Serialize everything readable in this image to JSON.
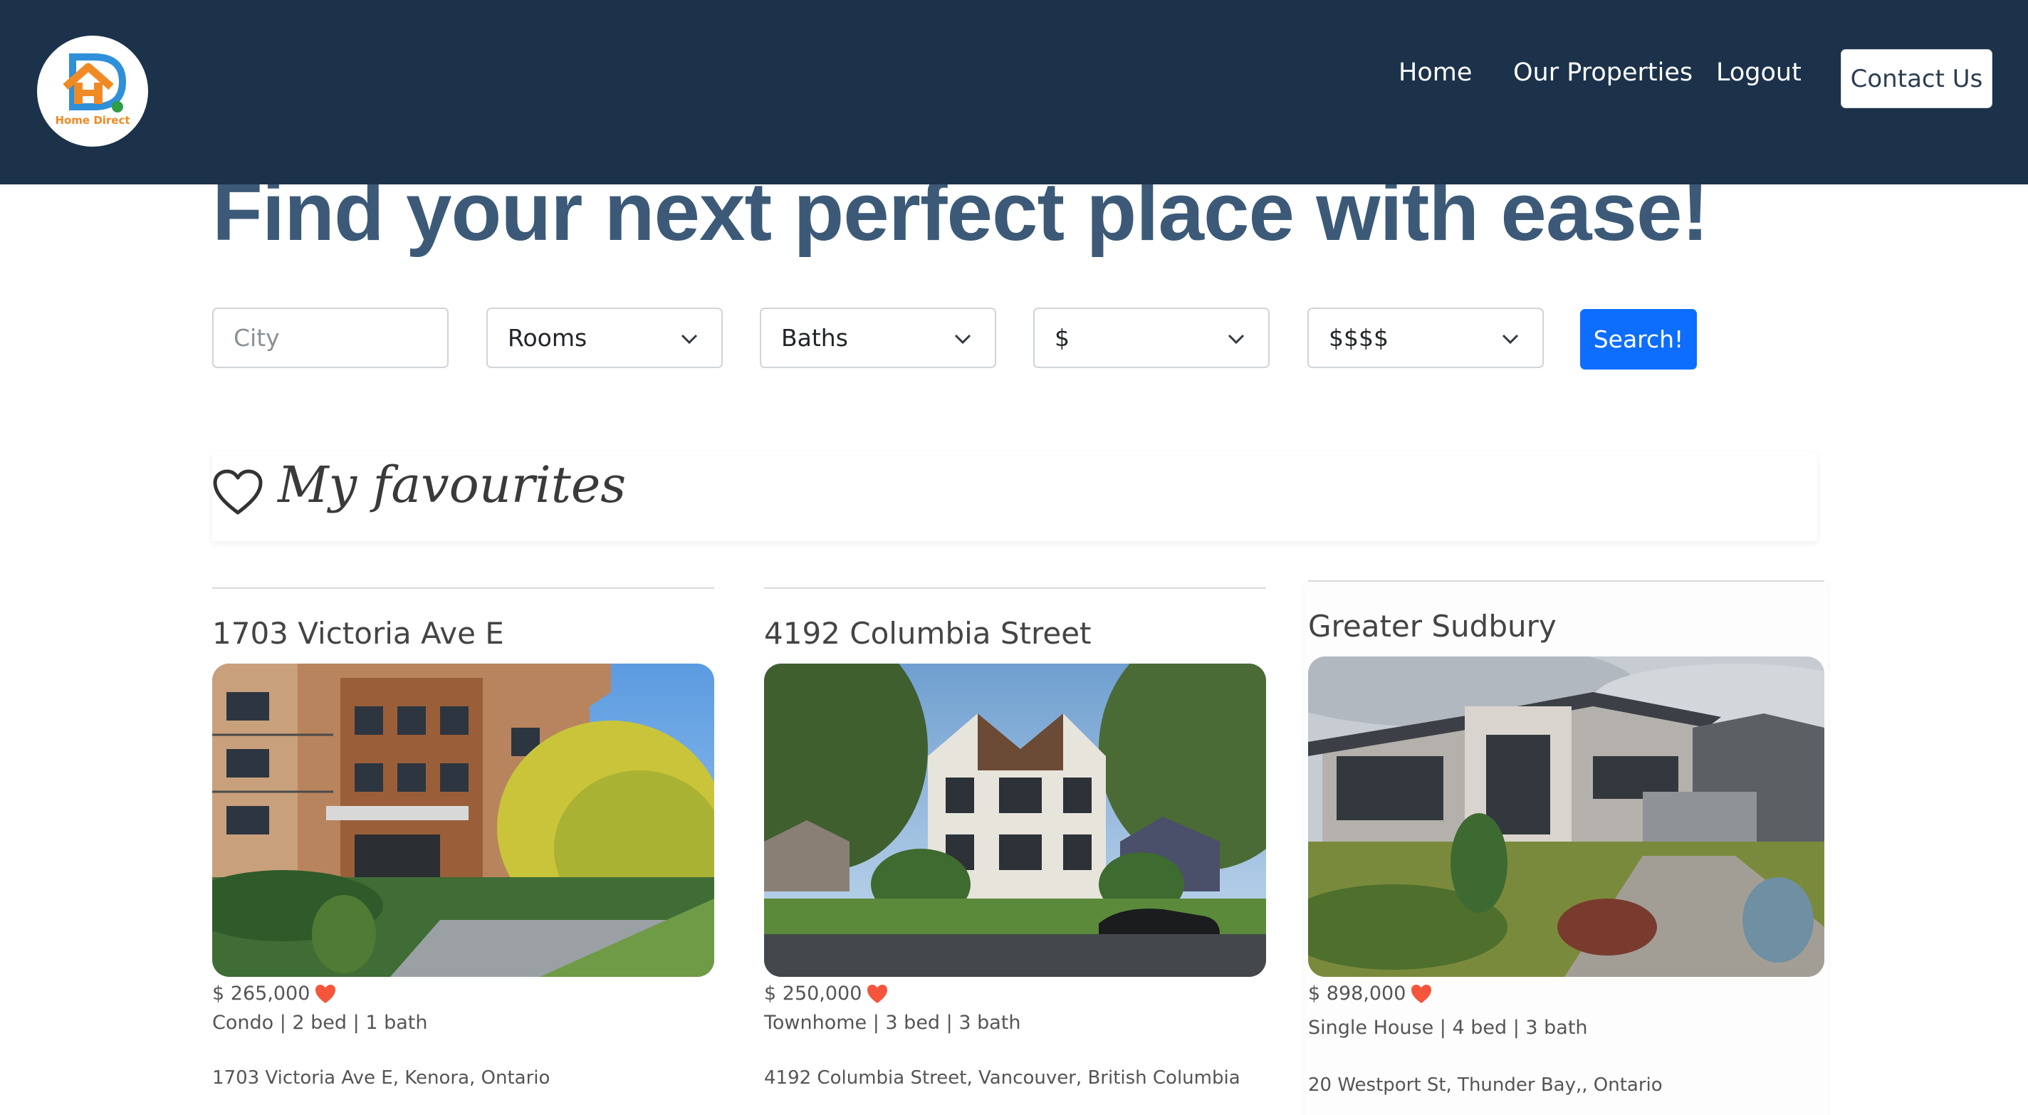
{
  "brand": {
    "logo_text": "Home Direct",
    "primary_color": "#1c324b",
    "accent": "#f08a24"
  },
  "nav": {
    "home": "Home",
    "properties": "Our Properties",
    "logout": "Logout",
    "contact": "Contact Us"
  },
  "hero": {
    "title": "Find your next perfect place with ease!"
  },
  "search": {
    "city_placeholder": "City",
    "rooms": "Rooms",
    "baths": "Baths",
    "min_price": "$",
    "max_price": "$$$$",
    "button": "Search!",
    "button_color": "#0d6efd"
  },
  "favourites": {
    "title": "My favourites",
    "icon": "heart-outline-icon"
  },
  "cards": [
    {
      "title": "1703 Victoria Ave E",
      "price": "$ 265,000",
      "details": "Condo | 2 bed | 1 bath",
      "address": "1703 Victoria Ave E, Kenora, Ontario",
      "favorite": true
    },
    {
      "title": "4192 Columbia Street",
      "price": "$ 250,000",
      "details": "Townhome | 3 bed | 3 bath",
      "address": "4192 Columbia Street, Vancouver, British Columbia",
      "favorite": true
    },
    {
      "title": "Greater Sudbury",
      "price": "$ 898,000",
      "details": "Single House | 4 bed | 3 bath",
      "address": "20 Westport St, Thunder Bay,, Ontario",
      "favorite": true
    }
  ],
  "heart_color": "#f4553b"
}
